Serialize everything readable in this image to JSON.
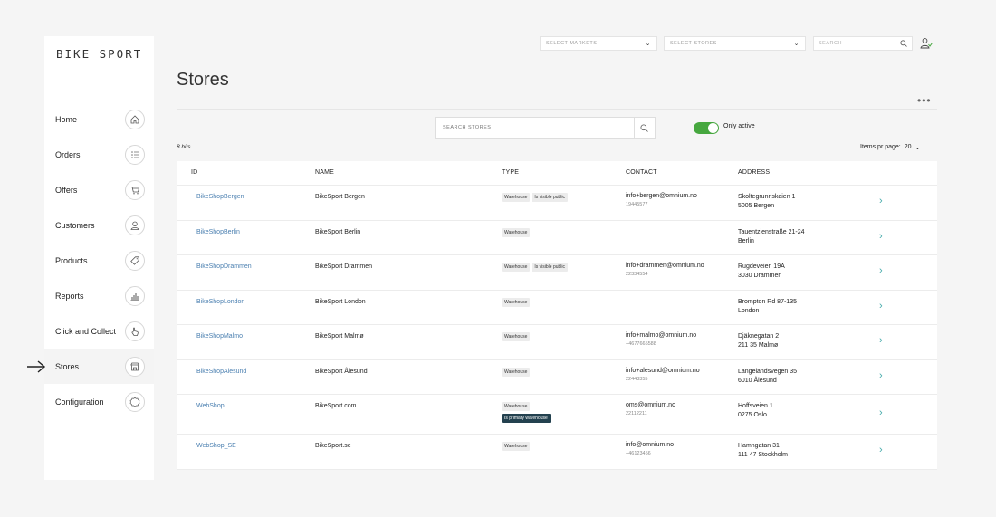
{
  "brand": {
    "logo": "BIKE SPORT"
  },
  "sidebar": {
    "items": [
      {
        "label": "Home",
        "icon": "home-icon"
      },
      {
        "label": "Orders",
        "icon": "list-icon"
      },
      {
        "label": "Offers",
        "icon": "cart-icon"
      },
      {
        "label": "Customers",
        "icon": "user-icon"
      },
      {
        "label": "Products",
        "icon": "tag-icon"
      },
      {
        "label": "Reports",
        "icon": "chart-icon"
      },
      {
        "label": "Click and Collect",
        "icon": "hand-icon"
      },
      {
        "label": "Stores",
        "icon": "store-icon",
        "active": true
      },
      {
        "label": "Configuration",
        "icon": "gear-icon"
      }
    ]
  },
  "topbar": {
    "markets_placeholder": "SELECT MARKETS",
    "stores_placeholder": "SELECT STORES",
    "search_placeholder": "SEARCH"
  },
  "page": {
    "title": "Stores",
    "more": "•••",
    "search_placeholder": "SEARCH STORES",
    "toggle_label": "Only active",
    "toggle_on": true,
    "hits": "8 hits",
    "items_per_page_label": "Items pr page:",
    "items_per_page_value": "20"
  },
  "table": {
    "headers": [
      "ID",
      "NAME",
      "TYPE",
      "CONTACT",
      "ADDRESS"
    ],
    "rows": [
      {
        "id": "BikeShopBergen",
        "name": "BikeSport Bergen",
        "types": [
          "Warehouse",
          "Is visible public"
        ],
        "primary": "",
        "email": "info+bergen@omnium.no",
        "phone": "19445577",
        "addr1": "Skoltegrunnskaien 1",
        "addr2": "5005 Bergen"
      },
      {
        "id": "BikeShopBerlin",
        "name": "BikeSport Berlin",
        "types": [
          "Warehouse"
        ],
        "primary": "",
        "email": "",
        "phone": "",
        "addr1": "Tauentzienstraße 21-24",
        "addr2": "Berlin"
      },
      {
        "id": "BikeShopDrammen",
        "name": "BikeSport Drammen",
        "types": [
          "Warehouse",
          "Is visible public"
        ],
        "primary": "",
        "email": "info+drammen@omnium.no",
        "phone": "22334554",
        "addr1": "Rugdeveien 19A",
        "addr2": "3030 Drammen"
      },
      {
        "id": "BikeShopLondon",
        "name": "BikeSport London",
        "types": [
          "Warehouse"
        ],
        "primary": "",
        "email": "",
        "phone": "",
        "addr1": "Brompton Rd 87-135",
        "addr2": "London"
      },
      {
        "id": "BikeShopMalmo",
        "name": "BikeSport Malmø",
        "types": [
          "Warehouse"
        ],
        "primary": "",
        "email": "info+malmo@omnium.no",
        "phone": "+4677665588",
        "addr1": "Djäknegatan 2",
        "addr2": "211 35 Malmø"
      },
      {
        "id": "BikeShopAlesund",
        "name": "BikeSport Ålesund",
        "types": [
          "Warehouse"
        ],
        "primary": "",
        "email": "info+alesund@omnium.no",
        "phone": "22443355",
        "addr1": "Langelandsvegen 35",
        "addr2": "6010 Ålesund"
      },
      {
        "id": "WebShop",
        "name": "BikeSport.com",
        "types": [
          "Warehouse"
        ],
        "primary": "Is primary warehouse",
        "email": "oms@omnium.no",
        "phone": "22112211",
        "addr1": "Hoffsveien 1",
        "addr2": "0275 Oslo"
      },
      {
        "id": "WebShop_SE",
        "name": "BikeSport.se",
        "types": [
          "Warehouse"
        ],
        "primary": "",
        "email": "info@omnium.no",
        "phone": "+46123456",
        "addr1": "Hamngatan 31",
        "addr2": "111 47 Stockholm"
      }
    ]
  },
  "colors": {
    "accent": "#46a73f",
    "link": "#4a7fb0",
    "badge_dark": "#23414f"
  }
}
